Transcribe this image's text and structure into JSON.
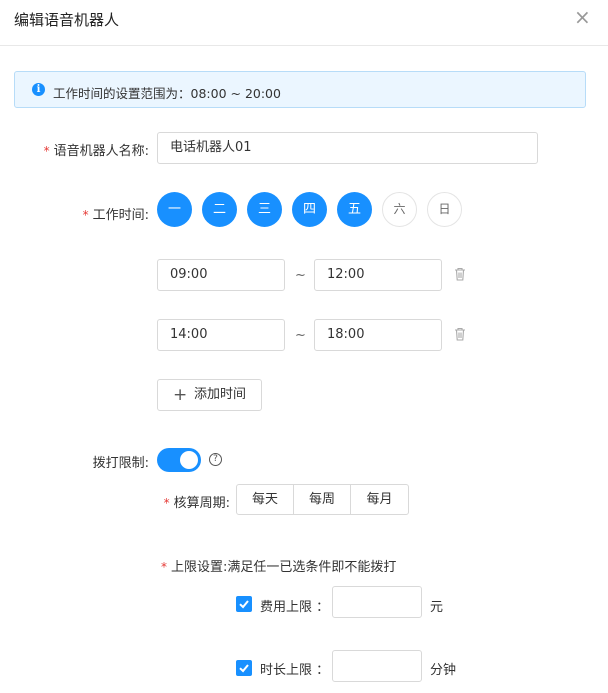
{
  "dialog": {
    "title": "编辑语音机器人",
    "close_icon": "×"
  },
  "alert": {
    "text": "工作时间的设置范围为：08:00 ~ 20:00"
  },
  "form": {
    "required_mark": "*",
    "robot_name": {
      "label": "语音机器人名称:",
      "value": "电话机器人01"
    },
    "work_time": {
      "label": "工作时间:",
      "days": [
        {
          "label": "一",
          "selected": true
        },
        {
          "label": "二",
          "selected": true
        },
        {
          "label": "三",
          "selected": true
        },
        {
          "label": "四",
          "selected": true
        },
        {
          "label": "五",
          "selected": true
        },
        {
          "label": "六",
          "selected": false
        },
        {
          "label": "日",
          "selected": false
        }
      ],
      "ranges": [
        {
          "start": "09:00",
          "end": "12:00"
        },
        {
          "start": "14:00",
          "end": "18:00"
        }
      ],
      "separator": "~",
      "add_button": "添加时间",
      "add_icon": "+"
    },
    "dial_limit": {
      "label": "拨打限制:",
      "enabled": true,
      "help_icon": "?"
    },
    "period": {
      "label": "核算周期:",
      "options": [
        "每天",
        "每周",
        "每月"
      ]
    },
    "limit_settings": {
      "label": "上限设置:",
      "description": "满足任一已选条件即不能拨打",
      "cost": {
        "label": "费用上限  ：",
        "checked": true,
        "value": "",
        "unit": "元"
      },
      "duration": {
        "label": "时长上限  ：",
        "checked": true,
        "value": "",
        "unit": "分钟"
      }
    }
  },
  "colors": {
    "primary": "#1890ff",
    "required": "#e53935",
    "alert_bg": "#ebf6ff",
    "alert_border": "#b7dcf8"
  }
}
